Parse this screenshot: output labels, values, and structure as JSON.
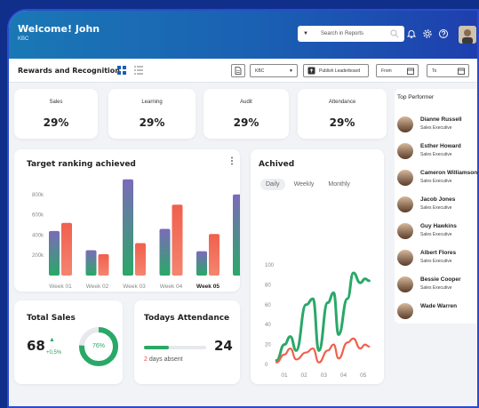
{
  "header": {
    "welcome": "Welcome! John",
    "org": "KBC",
    "search_placeholder": "Search in Reports"
  },
  "toolbar": {
    "title": "Rewards and Recognition",
    "select_value": "KBC",
    "publish_label": "Publish Leaderboard",
    "from_label": "From",
    "to_label": "To"
  },
  "kpis": [
    {
      "label": "Sales",
      "value": "29%"
    },
    {
      "label": "Learning",
      "value": "29%"
    },
    {
      "label": "Audit",
      "value": "29%"
    },
    {
      "label": "Attendance",
      "value": "29%"
    }
  ],
  "target_chart": {
    "title": "Target ranking achieved"
  },
  "achived": {
    "title": "Achived",
    "tabs": [
      "Daily",
      "Weekly",
      "Monthly"
    ],
    "active_tab": "Daily"
  },
  "total_sales": {
    "title": "Total Sales",
    "value": "68",
    "change": "+0,5%",
    "percent": "76%",
    "percent_value": 0.76
  },
  "attendance": {
    "title": "Todays Attendance",
    "value": "24",
    "absent_count": "2",
    "absent_text": "days absent",
    "bar_fraction": 0.4
  },
  "top_performer": {
    "title": "Top Performer",
    "people": [
      {
        "name": "Dianne Russell",
        "role": "Sales Executive"
      },
      {
        "name": "Esther Howard",
        "role": "Sales Executive"
      },
      {
        "name": "Cameron Williamson",
        "role": "Sales Executive"
      },
      {
        "name": "Jacob Jones",
        "role": "Sales Executive"
      },
      {
        "name": "Guy Hawkins",
        "role": "Sales Executive"
      },
      {
        "name": "Albert Flores",
        "role": "Sales Executive"
      },
      {
        "name": "Bessie Cooper",
        "role": "Sales Executive"
      },
      {
        "name": "Wade Warren",
        "role": ""
      }
    ]
  },
  "colors": {
    "purple": "#7b6bb8",
    "green": "#2aa868",
    "red": "#f0604d",
    "accent": "#1a5fb3"
  },
  "chart_data": [
    {
      "type": "bar",
      "title": "Target ranking achieved",
      "categories": [
        "Week 01",
        "Week 02",
        "Week 03",
        "Week 04",
        "Week 05"
      ],
      "y_ticks": [
        "200k",
        "400k",
        "600k",
        "800k"
      ],
      "ylim": [
        0,
        1000
      ],
      "series": [
        {
          "values": [
            440,
            250,
            950,
            460,
            240
          ]
        },
        {
          "values": [
            520,
            210,
            320,
            700,
            410
          ]
        }
      ],
      "partial_bar_after_last": 800
    },
    {
      "type": "line",
      "title": "Achived",
      "x": [
        "01",
        "02",
        "03",
        "04",
        "05"
      ],
      "y_ticks": [
        "0",
        "20",
        "40",
        "60",
        "80",
        "100"
      ],
      "ylim": [
        0,
        100
      ],
      "series": [
        {
          "points": [
            [
              0.6,
              4
            ],
            [
              1.0,
              20
            ],
            [
              1.3,
              28
            ],
            [
              1.6,
              14
            ],
            [
              2.1,
              60
            ],
            [
              2.45,
              66
            ],
            [
              2.75,
              14
            ],
            [
              3.2,
              62
            ],
            [
              3.5,
              72
            ],
            [
              3.75,
              30
            ],
            [
              4.2,
              66
            ],
            [
              4.5,
              92
            ],
            [
              4.85,
              82
            ],
            [
              5.1,
              86
            ],
            [
              5.3,
              84
            ]
          ]
        },
        {
          "points": [
            [
              0.6,
              2
            ],
            [
              1.0,
              10
            ],
            [
              1.3,
              16
            ],
            [
              1.6,
              5
            ],
            [
              2.1,
              12
            ],
            [
              2.45,
              16
            ],
            [
              2.75,
              2
            ],
            [
              3.2,
              14
            ],
            [
              3.5,
              20
            ],
            [
              3.75,
              6
            ],
            [
              4.2,
              22
            ],
            [
              4.5,
              26
            ],
            [
              4.85,
              16
            ],
            [
              5.1,
              20
            ],
            [
              5.3,
              18
            ]
          ]
        }
      ]
    }
  ]
}
